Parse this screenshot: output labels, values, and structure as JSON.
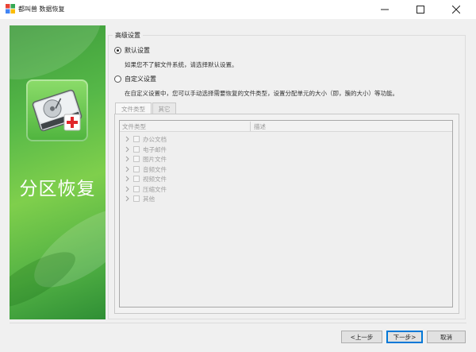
{
  "window": {
    "title": "都叫兽 数据恢复"
  },
  "banner": {
    "title": "分区恢复",
    "icon": "hard-disk-medical-icon",
    "colors": {
      "green_dark": "#2f8f35",
      "green_light": "#7fcf4c"
    }
  },
  "settings": {
    "group_title": "高级设置",
    "default_option": {
      "label": "默认设置",
      "selected": true,
      "description": "如果您不了解文件系统，请选择默认设置。"
    },
    "custom_option": {
      "label": "自定义设置",
      "selected": false,
      "description": "在自定义设置中，您可以手动选择需要恢复的文件类型，设置分配单元的大小（即，簇的大小）等功能。"
    },
    "tabs": [
      {
        "label": "文件类型",
        "active": true
      },
      {
        "label": "其它",
        "active": false
      }
    ],
    "table": {
      "columns": [
        "文件类型",
        "描述"
      ],
      "rows": [
        {
          "label": "办公文档",
          "checked": false
        },
        {
          "label": "电子邮件",
          "checked": false
        },
        {
          "label": "图片文件",
          "checked": false
        },
        {
          "label": "音频文件",
          "checked": false
        },
        {
          "label": "视频文件",
          "checked": false
        },
        {
          "label": "压缩文件",
          "checked": false
        },
        {
          "label": "其他",
          "checked": false
        }
      ]
    }
  },
  "footer": {
    "back_label": "<上一步",
    "next_label": "下一步>",
    "cancel_label": "取消"
  }
}
